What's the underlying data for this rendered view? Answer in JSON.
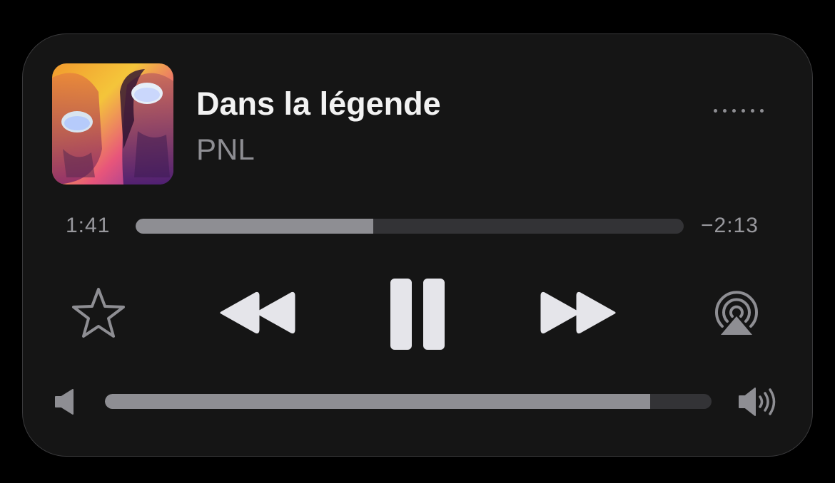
{
  "track": {
    "title": "Dans la légende",
    "artist": "PNL"
  },
  "progress": {
    "elapsed": "1:41",
    "remaining": "−2:13",
    "fraction": 0.434
  },
  "volume": {
    "fraction": 0.899
  },
  "controls": {
    "favorite_icon": "star-outline-icon",
    "rewind_icon": "rewind-icon",
    "play_pause_icon": "pause-icon",
    "forward_icon": "fast-forward-icon",
    "airplay_icon": "airplay-icon",
    "more_icon": "more-dots-icon",
    "volume_low_icon": "speaker-low-icon",
    "volume_high_icon": "speaker-high-icon"
  },
  "colors": {
    "card_background": "#151515",
    "primary_text": "#f2f2f2",
    "secondary_text": "#8e8e93",
    "control_glyph": "#e5e5ea",
    "track_fill": "#8e8e93",
    "track_empty": "#333336"
  }
}
